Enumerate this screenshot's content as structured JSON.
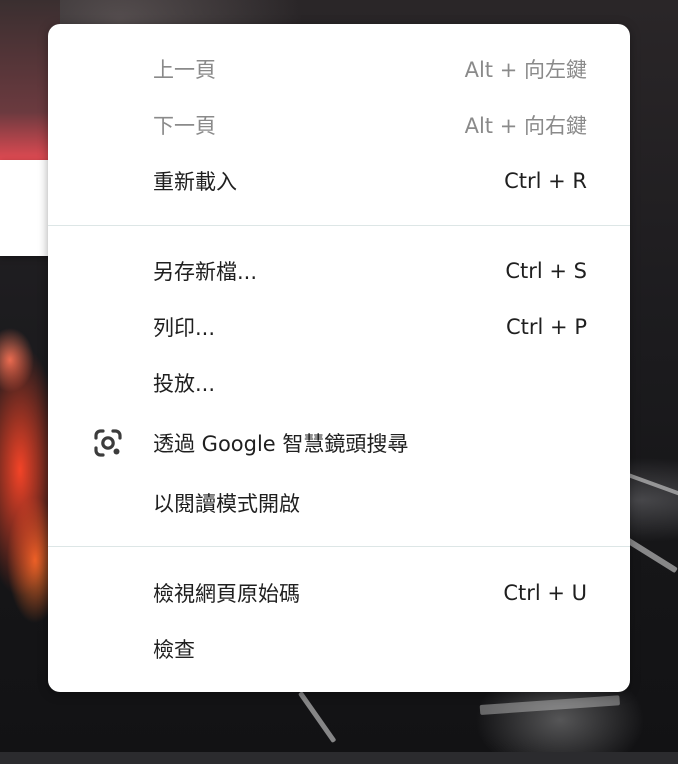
{
  "menu": {
    "items": [
      {
        "label": "上一頁",
        "shortcut": "Alt + 向左鍵",
        "disabled": true
      },
      {
        "label": "下一頁",
        "shortcut": "Alt + 向右鍵",
        "disabled": true
      },
      {
        "label": "重新載入",
        "shortcut": "Ctrl + R",
        "disabled": false
      },
      {
        "label": "另存新檔...",
        "shortcut": "Ctrl + S",
        "disabled": false
      },
      {
        "label": "列印...",
        "shortcut": "Ctrl + P",
        "disabled": false
      },
      {
        "label": "投放...",
        "shortcut": "",
        "disabled": false
      },
      {
        "label": "透過 Google 智慧鏡頭搜尋",
        "shortcut": "",
        "disabled": false,
        "icon": "google-lens-icon"
      },
      {
        "label": "以閱讀模式開啟",
        "shortcut": "",
        "disabled": false
      },
      {
        "label": "檢視網頁原始碼",
        "shortcut": "Ctrl + U",
        "disabled": false
      },
      {
        "label": "檢查",
        "shortcut": "",
        "disabled": false
      }
    ]
  },
  "colors": {
    "menu_background": "#ffffff",
    "text_enabled": "#1f1f1f",
    "text_disabled": "#8a8a8a",
    "separator": "#dde6e6"
  }
}
